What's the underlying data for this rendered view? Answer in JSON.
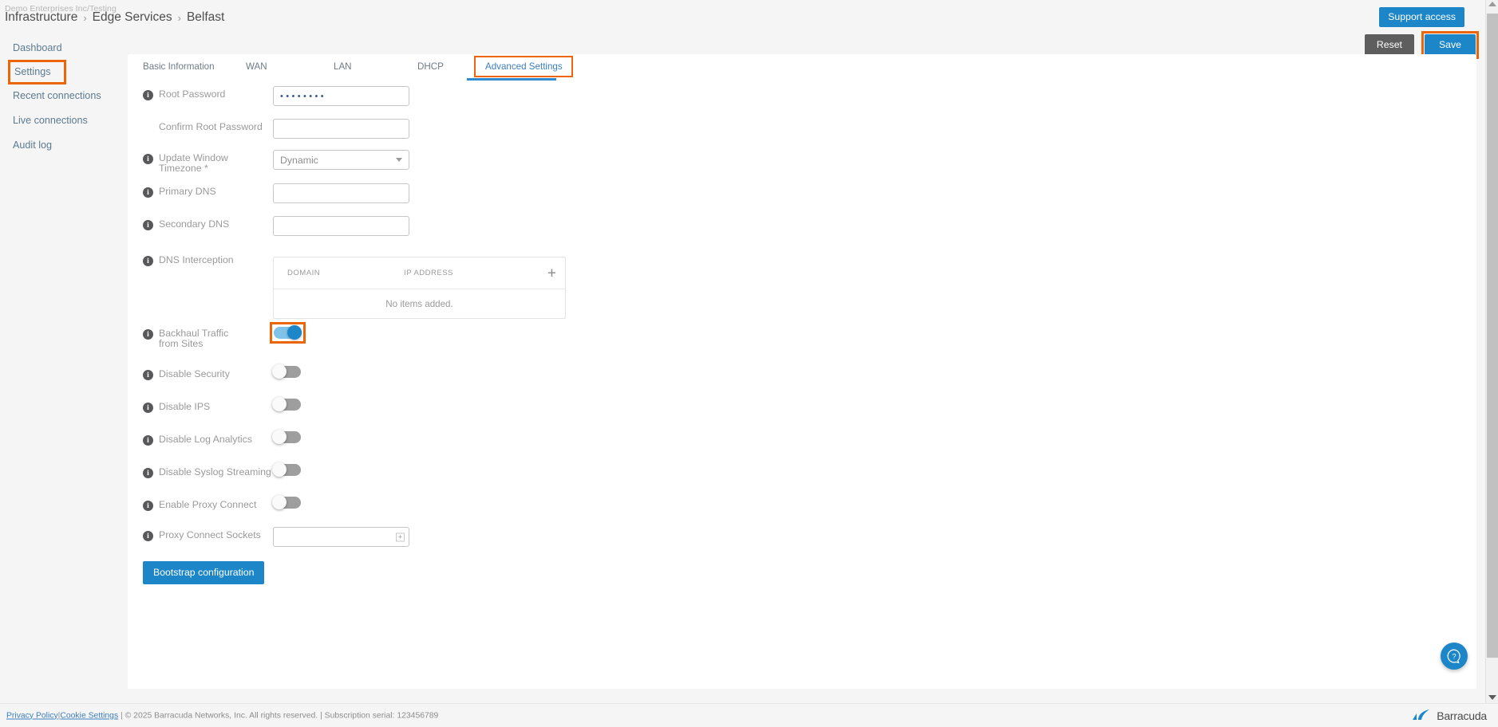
{
  "header": {
    "org": "Demo Enterprises Inc/Testing",
    "breadcrumb": [
      "Infrastructure",
      "Edge Services",
      "Belfast"
    ],
    "separator": "›",
    "support_access_label": "Support access"
  },
  "actions": {
    "reset_label": "Reset",
    "save_label": "Save"
  },
  "sidebar": {
    "items": [
      {
        "label": "Dashboard"
      },
      {
        "label": "Settings"
      },
      {
        "label": "Recent connections"
      },
      {
        "label": "Live connections"
      },
      {
        "label": "Audit log"
      }
    ]
  },
  "tabs": [
    {
      "label": "Basic Information"
    },
    {
      "label": "WAN"
    },
    {
      "label": "LAN"
    },
    {
      "label": "DHCP"
    },
    {
      "label": "Advanced Settings"
    }
  ],
  "form": {
    "root_password": {
      "label": "Root Password",
      "value": "••••••••",
      "placeholder": ""
    },
    "confirm_root_password": {
      "label": "Confirm Root Password",
      "value": "",
      "placeholder": ""
    },
    "update_window_timezone": {
      "label": "Update Window Timezone *",
      "value": "Dynamic"
    },
    "primary_dns": {
      "label": "Primary DNS",
      "value": "",
      "placeholder": ""
    },
    "secondary_dns": {
      "label": "Secondary DNS",
      "value": "",
      "placeholder": ""
    },
    "dns_interception": {
      "label": "DNS Interception",
      "columns": [
        "DOMAIN",
        "IP ADDRESS"
      ],
      "add_label": "+",
      "empty_text": "No items added."
    },
    "toggles": [
      {
        "label": "Backhaul Traffic from Sites",
        "state": "on"
      },
      {
        "label": "Disable Security",
        "state": "off"
      },
      {
        "label": "Disable IPS",
        "state": "off"
      },
      {
        "label": "Disable Log Analytics",
        "state": "off"
      },
      {
        "label": "Disable Syslog Streaming",
        "state": "off"
      },
      {
        "label": "Enable Proxy Connect",
        "state": "off"
      }
    ],
    "proxy_connect_sockets": {
      "label": "Proxy Connect Sockets",
      "value": "",
      "stepper_label": "+"
    },
    "bootstrap_label": "Bootstrap configuration"
  },
  "footer": {
    "privacy_policy": "Privacy Policy",
    "pipe1": "|",
    "cookie_settings": "Cookie Settings",
    "copyright": "| © 2025 Barracuda Networks, Inc. All rights reserved. | Subscription serial: 123456789",
    "brand": "Barracuda"
  },
  "colors": {
    "accent_blue": "#1c86c8",
    "highlight_orange": "#ec6608",
    "reset_gray": "#5e5e5e",
    "link_blue": "#3d7ebc"
  }
}
